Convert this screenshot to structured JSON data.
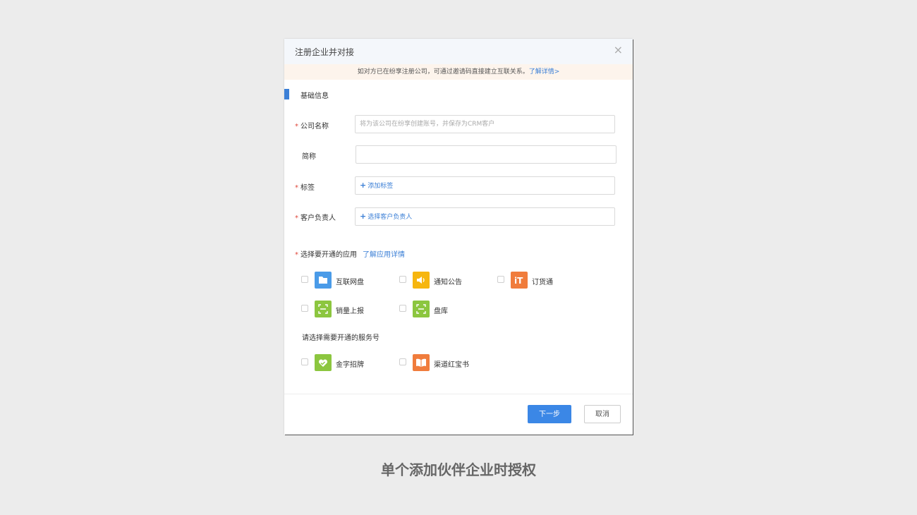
{
  "dialog": {
    "title": "注册企业并对接",
    "close_glyph": "×",
    "notice_text": "如对方已在纷享注册公司，可通过邀请码直接建立互联关系。",
    "notice_link": "了解详情>",
    "section_title": "基础信息"
  },
  "form": {
    "required_mark": "*",
    "company_name": {
      "label": "公司名称",
      "placeholder": "将为该公司在纷享创建账号，并保存为CRM客户",
      "value": ""
    },
    "short_name": {
      "label": "简称",
      "value": ""
    },
    "tags": {
      "label": "标签",
      "action": "添加标签"
    },
    "owner": {
      "label": "客户负责人",
      "action": "选择客户负责人"
    }
  },
  "apps": {
    "title": "选择要开通的应用",
    "detail_link": "了解应用详情",
    "items": [
      {
        "name": "互联网盘",
        "icon": "folder-icon",
        "color": "#4a9be8"
      },
      {
        "name": "通知公告",
        "icon": "speaker-icon",
        "color": "#f6b60f"
      },
      {
        "name": "订货通",
        "icon": "order-icon",
        "color": "#f07c3c"
      },
      {
        "name": "销量上报",
        "icon": "scan-icon",
        "color": "#8cc63f"
      },
      {
        "name": "盘库",
        "icon": "scan-icon",
        "color": "#8cc63f"
      }
    ],
    "service_title": "请选择需要开通的服务号",
    "services": [
      {
        "name": "金字招牌",
        "icon": "heart-icon",
        "color": "#8cc63f"
      },
      {
        "name": "渠道红宝书",
        "icon": "book-icon",
        "color": "#f07c3c"
      }
    ]
  },
  "footer": {
    "next_label": "下一步",
    "cancel_label": "取消"
  },
  "caption": "单个添加伙伴企业时授权",
  "colors": {
    "accent": "#3b87e6",
    "required": "#e0483c"
  }
}
